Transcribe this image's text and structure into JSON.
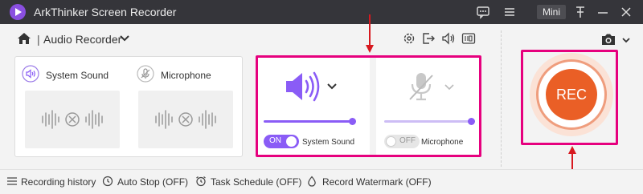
{
  "window": {
    "app_title": "ArkThinker Screen Recorder",
    "mini_label": "Mini",
    "icons": [
      "chat-icon",
      "menu-icon",
      "pin-icon",
      "minimize-icon",
      "close-icon"
    ]
  },
  "toolbar": {
    "mode_title": "Audio Recorder",
    "separator": "|",
    "icons": [
      "settings-icon",
      "export-icon",
      "speaker-icon",
      "fullscreen-icon",
      "camera-icon"
    ]
  },
  "left_panel": {
    "system_sound_label": "System Sound",
    "microphone_label": "Microphone"
  },
  "system_sound_card": {
    "toggle_label": "ON",
    "label": "System Sound",
    "enabled": true,
    "volume_percent": 100
  },
  "microphone_card": {
    "toggle_label": "OFF",
    "label": "Microphone",
    "enabled": false,
    "volume_percent": 100
  },
  "record_button": {
    "label": "REC"
  },
  "statusbar": {
    "recording_history": "Recording history",
    "auto_stop": "Auto Stop (OFF)",
    "task_schedule": "Task Schedule (OFF)",
    "record_watermark": "Record Watermark (OFF)"
  },
  "colors": {
    "accent": "#8a5cf6",
    "highlight": "#e6007e",
    "record": "#ea5f26",
    "titlebar": "#35353a"
  }
}
